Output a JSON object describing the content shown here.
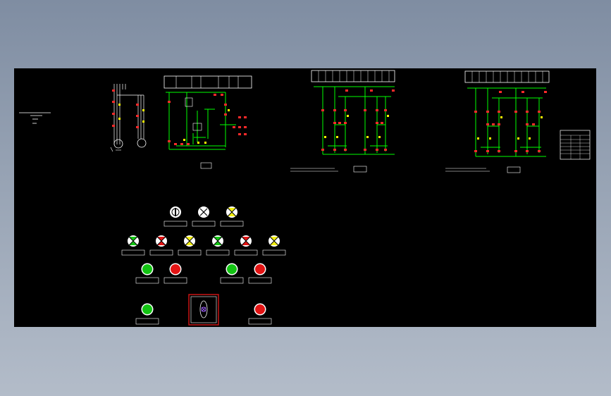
{
  "colors": {
    "background_top": "#7f8da2",
    "background_bottom": "#b3bcc9",
    "drawing_area": "#000000",
    "wire_green": "#00ff00",
    "contact_red": "#ff2a2a",
    "contact_yellow": "#ffff00",
    "line_white": "#ffffff",
    "lamp_green": "#13c413",
    "lamp_red": "#e31414",
    "lamp_yellow": "#f2ee12",
    "frame_red": "#c81414"
  },
  "panel": {
    "lamp_rows": [
      [
        "selector",
        "pilot-white",
        "pilot-yellow"
      ],
      [
        "pilot-green",
        "pilot-red",
        "pilot-yellow",
        "pilot-green",
        "pilot-red",
        "pilot-yellow"
      ]
    ],
    "button_rows": [
      [
        "button-green",
        "button-red",
        "button-green",
        "button-red"
      ],
      [
        "button-green",
        "emergency-stop",
        "button-red"
      ]
    ]
  }
}
